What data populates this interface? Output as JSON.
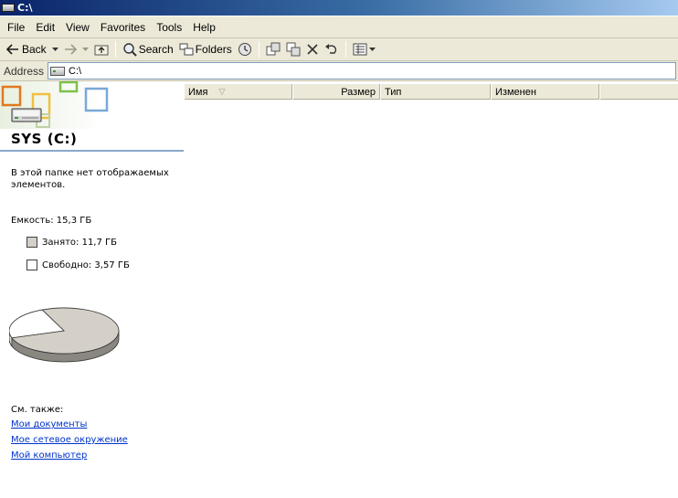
{
  "window": {
    "title": "C:\\"
  },
  "menu": [
    "File",
    "Edit",
    "View",
    "Favorites",
    "Tools",
    "Help"
  ],
  "toolbar": {
    "back_label": "Back",
    "search_label": "Search",
    "folders_label": "Folders"
  },
  "address": {
    "label": "Address",
    "value": "C:\\"
  },
  "task_pane": {
    "title": "SYS (C:)",
    "empty_message": "В этой папке нет отображаемых элементов.",
    "capacity": "Емкость: 15,3 ГБ",
    "used": "Занято: 11,7 ГБ",
    "free": "Свободно: 3,57 ГБ",
    "used_fraction": 0.765,
    "colors": {
      "used": "#d4d0c8",
      "free": "#ffffff"
    },
    "see_also_label": "См. также:",
    "links": [
      "Мои документы",
      "Мое сетевое окружение",
      "Мой компьютер"
    ]
  },
  "columns": [
    "Имя",
    "Размер",
    "Тип",
    "Изменен"
  ]
}
